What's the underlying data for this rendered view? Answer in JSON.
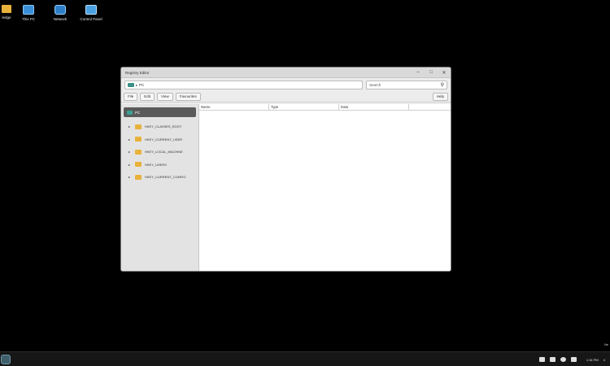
{
  "desktop": {
    "icons": [
      {
        "label": "ledge",
        "icon": "folder-icon"
      },
      {
        "label": "This PC",
        "icon": "this-pc-icon"
      },
      {
        "label": "Network",
        "icon": "network-icon"
      },
      {
        "label": "Control Panel",
        "icon": "control-panel-icon"
      }
    ]
  },
  "window": {
    "title": "Registry Editor",
    "controls": {
      "minimize": "–",
      "maximize": "□",
      "close": "✕"
    },
    "address": {
      "arrow": "▸",
      "path": "PC"
    },
    "search": {
      "placeholder": "Search",
      "icon": "⚲"
    },
    "menu": [
      "File",
      "Edit",
      "View",
      "Favourites"
    ],
    "help": "Help",
    "tree": {
      "root": "PC",
      "items": [
        "HKEY_CLASSES_ROOT",
        "HKEY_CURRENT_USER",
        "HKEY_LOCAL_MACHINE",
        "HKEY_USERS",
        "HKEY_CURRENT_CONFIG"
      ]
    },
    "columns": [
      "Name",
      "Type",
      "Data"
    ]
  },
  "taskbar": {
    "clock": "1:34 PM",
    "tray_extra": "4",
    "notification": "Ne"
  },
  "colors": {
    "desktop_bg": "#000000",
    "folder": "#e8b23a",
    "tree_selected": "#5a5a5a"
  }
}
